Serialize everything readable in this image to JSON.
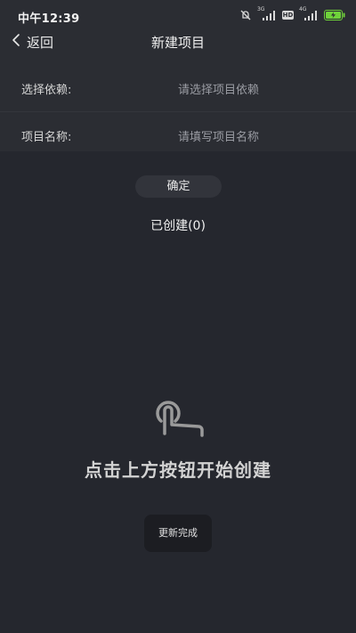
{
  "status_bar": {
    "time": "中午12:39",
    "icons": [
      "mute-icon",
      "3g-signal-icon",
      "hd-icon",
      "4g-signal-icon",
      "battery-charging-icon"
    ],
    "signal_3g_label": "3G",
    "hd_label": "HD",
    "signal_4g_label": "4G",
    "battery_color": "#6fd23a"
  },
  "nav": {
    "back_label": "返回",
    "title": "新建项目"
  },
  "form": {
    "dependency": {
      "label": "选择依赖:",
      "placeholder": "请选择项目依赖"
    },
    "name": {
      "label": "项目名称:",
      "placeholder": "请填写项目名称"
    }
  },
  "confirm_label": "确定",
  "created_label": "已创建(0)",
  "empty_state": {
    "icon": "tap-gesture-icon",
    "hint": "点击上方按钮开始创建"
  },
  "toast": "更新完成"
}
